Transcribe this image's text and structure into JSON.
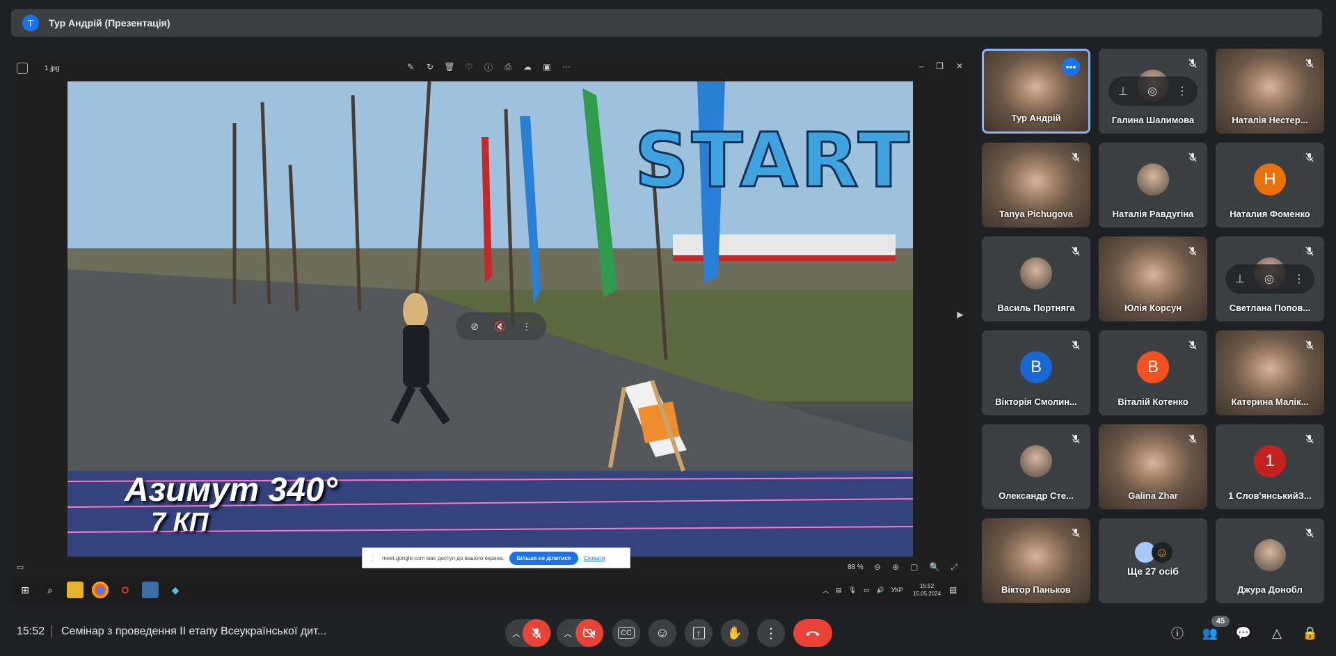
{
  "banner": {
    "avatar_letter": "T",
    "title": "Тур Андрій (Презентація)"
  },
  "viewer": {
    "file_name": "1.jpg",
    "zoom": "88 %",
    "overlay_start": "START",
    "overlay_azimuth": "Азимут 340°",
    "overlay_kp": "7 КП"
  },
  "share_notice": {
    "message": "meet.google.com має доступ до вашого екрана.",
    "stop_label": "Більше не ділитися",
    "hide_label": "Сховати"
  },
  "taskbar": {
    "language": "УКР",
    "time": "15:52",
    "date": "15.05.2024"
  },
  "participants": [
    {
      "name": "Тур Андрій",
      "type": "video",
      "active": true,
      "muted": false
    },
    {
      "name": "Галина Шалимова",
      "type": "photo",
      "muted": true
    },
    {
      "name": "Наталія Нестер...",
      "type": "video",
      "muted": true
    },
    {
      "name": "Tanya Pichugova",
      "type": "video",
      "muted": true
    },
    {
      "name": "Наталія Равдугіна",
      "type": "photo",
      "muted": true
    },
    {
      "name": "Наталия Фоменко",
      "type": "letter",
      "letter": "Н",
      "color": "#e8710a",
      "muted": true
    },
    {
      "name": "Василь Портняга",
      "type": "photo",
      "muted": true
    },
    {
      "name": "Юлія Корсун",
      "type": "video",
      "muted": true
    },
    {
      "name": "Светлана Попов...",
      "type": "photo",
      "muted": true
    },
    {
      "name": "Вікторія Смолин...",
      "type": "letter",
      "letter": "В",
      "color": "#1967d2",
      "muted": true
    },
    {
      "name": "Віталій Котенко",
      "type": "letter",
      "letter": "В",
      "color": "#f4511e",
      "muted": true
    },
    {
      "name": "Катерина Малік...",
      "type": "video",
      "muted": true
    },
    {
      "name": "Олександр Сте...",
      "type": "photo",
      "muted": true
    },
    {
      "name": "Galina Zhar",
      "type": "video",
      "muted": true
    },
    {
      "name": "1 Слов'янськийЗ...",
      "type": "letter",
      "letter": "1",
      "color": "#c5221f",
      "muted": true
    },
    {
      "name": "Віктор Паньков",
      "type": "video",
      "muted": true
    },
    {
      "name": "Ще 27 осіб",
      "type": "more",
      "muted": false
    },
    {
      "name": "Джура Донобл",
      "type": "photo",
      "muted": true
    }
  ],
  "bottom_bar": {
    "time": "15:52",
    "meeting_title": "Семінар з проведення ІІ етапу Всеукраїнської дит...",
    "participant_count": "45"
  },
  "colors": {
    "background": "#202124",
    "tile": "#3c4043",
    "accent": "#1a73e8",
    "danger": "#ea4335"
  }
}
